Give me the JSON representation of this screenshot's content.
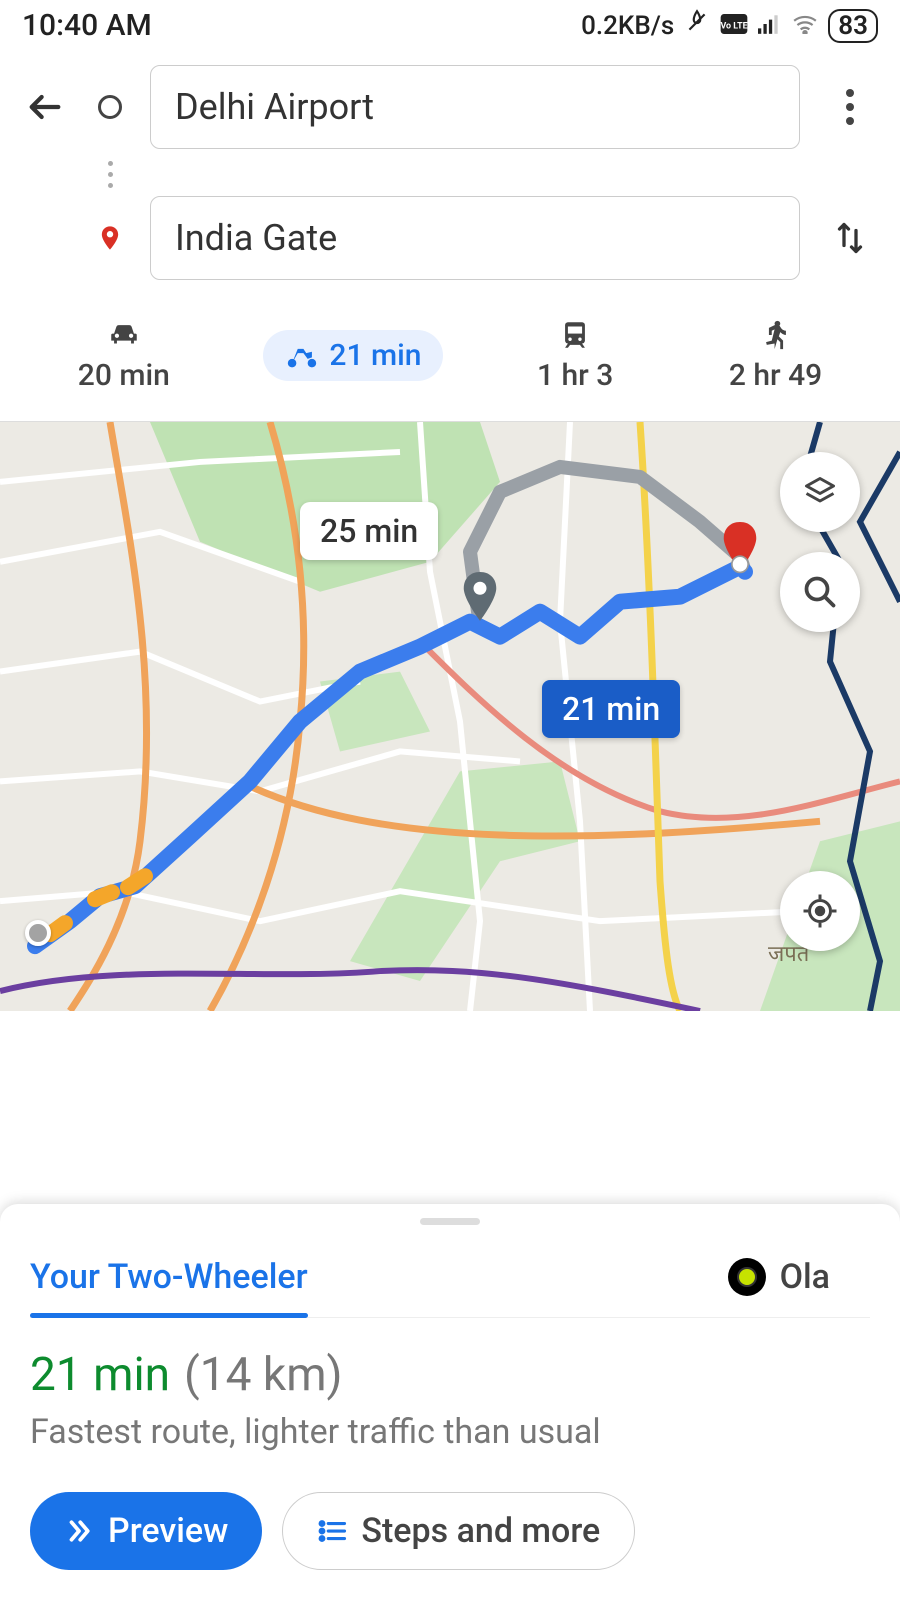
{
  "status": {
    "time": "10:40 AM",
    "data_rate": "0.2KB/s",
    "battery": "83"
  },
  "directions": {
    "origin": "Delhi Airport",
    "destination": "India Gate"
  },
  "modes": {
    "car": {
      "label": "20 min"
    },
    "two_wheeler": {
      "label": "21 min"
    },
    "transit": {
      "label": "1 hr 3"
    },
    "walk": {
      "label": "2 hr 49"
    }
  },
  "map": {
    "alt_route_label": "25 min",
    "main_route_label": "21 min"
  },
  "sheet": {
    "tabs": {
      "own": "Your Two-Wheeler",
      "ride": "Ola"
    },
    "time": "21 min",
    "distance": "(14 km)",
    "description": "Fastest route, lighter traffic than usual",
    "preview_btn": "Preview",
    "steps_btn": "Steps and more"
  }
}
